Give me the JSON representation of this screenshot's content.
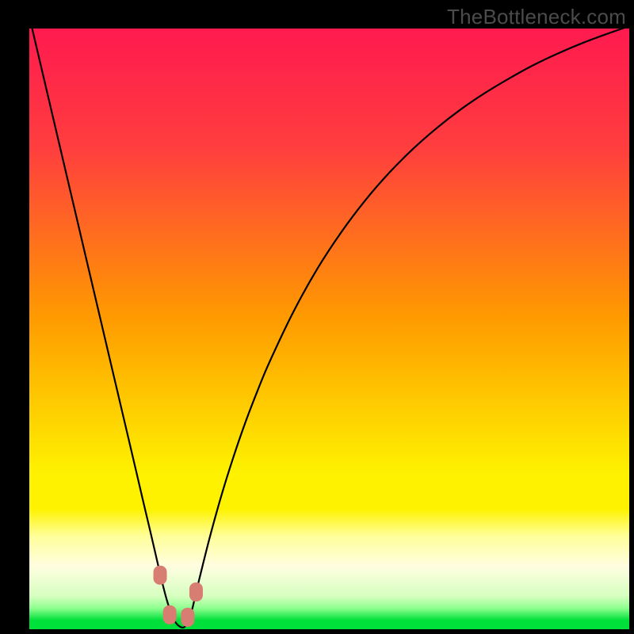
{
  "watermark": "TheBottleneck.com",
  "colors": {
    "black": "#000000",
    "curve": "#000000",
    "marker_fill": "#d77d72",
    "marker_stroke": "#b85e53",
    "green": "#00e03b",
    "yellow": "#fef200",
    "orange": "#ff9a00",
    "red_top": "#ff1a4f",
    "red_mid": "#ff3e3e"
  },
  "chart_data": {
    "type": "line",
    "title": "",
    "xlabel": "",
    "ylabel": "",
    "xlim": [
      0,
      100
    ],
    "ylim": [
      0,
      100
    ],
    "x": [
      0,
      2,
      4,
      6,
      8,
      10,
      12,
      14,
      16,
      18,
      19,
      20,
      21,
      22,
      23,
      24,
      25,
      26,
      27,
      28,
      30,
      32,
      34,
      36,
      38,
      40,
      44,
      48,
      52,
      56,
      60,
      64,
      68,
      72,
      76,
      80,
      84,
      88,
      92,
      96,
      100
    ],
    "values": [
      102,
      93.5,
      85,
      76.5,
      68,
      59.5,
      51,
      42.5,
      34,
      25.5,
      21.2,
      17,
      12.7,
      8.4,
      4.6,
      1.8,
      0.5,
      0.5,
      2.8,
      7.0,
      15.0,
      22.2,
      28.6,
      34.4,
      39.6,
      44.4,
      52.8,
      60.0,
      66.1,
      71.4,
      76.0,
      80.0,
      83.5,
      86.6,
      89.3,
      91.7,
      93.9,
      95.8,
      97.5,
      99.0,
      100.4
    ],
    "markers": [
      {
        "x": 21.8,
        "y": 9.0
      },
      {
        "x": 23.4,
        "y": 2.4
      },
      {
        "x": 26.4,
        "y": 2.0
      },
      {
        "x": 27.8,
        "y": 6.2
      }
    ],
    "gradient_stops": [
      {
        "pos": 0.0,
        "color": "#ff1a4f"
      },
      {
        "pos": 0.2,
        "color": "#ff3e3e"
      },
      {
        "pos": 0.48,
        "color": "#ff9a00"
      },
      {
        "pos": 0.74,
        "color": "#fef200"
      },
      {
        "pos": 0.8,
        "color": "#fef200"
      },
      {
        "pos": 0.845,
        "color": "#ffff9a"
      },
      {
        "pos": 0.895,
        "color": "#fffde0"
      },
      {
        "pos": 0.945,
        "color": "#d6ffc0"
      },
      {
        "pos": 0.965,
        "color": "#8eff8e"
      },
      {
        "pos": 0.985,
        "color": "#00e03b"
      },
      {
        "pos": 1.0,
        "color": "#00e03b"
      }
    ]
  }
}
